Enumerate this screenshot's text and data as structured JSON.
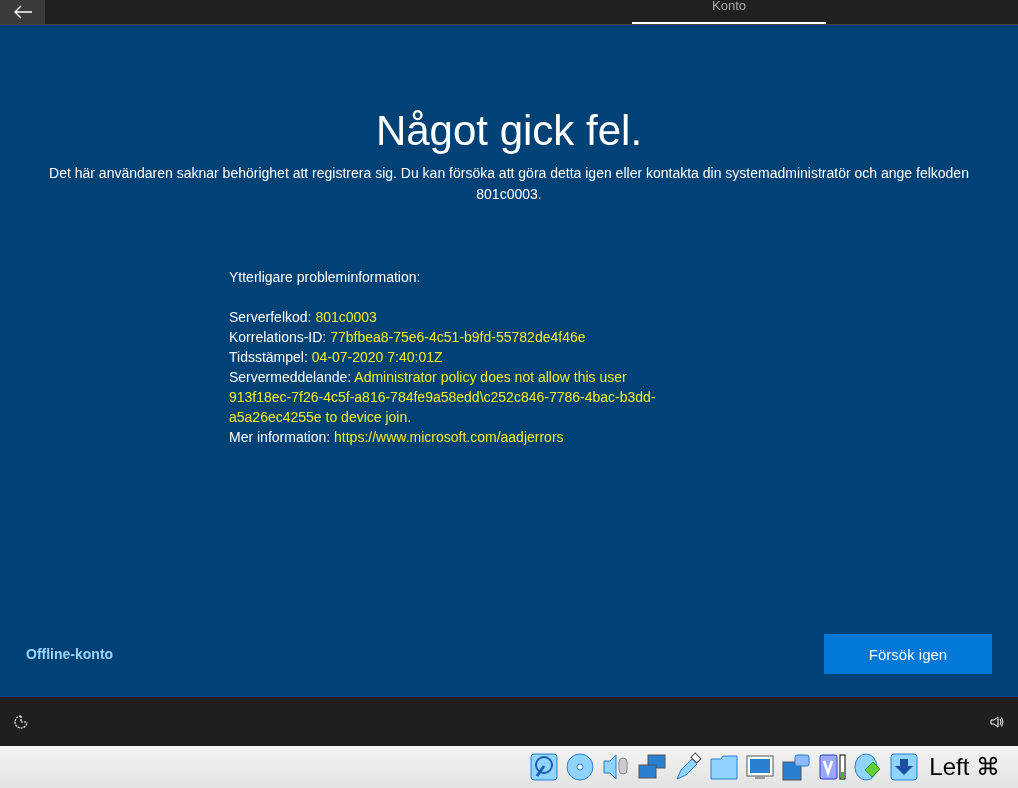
{
  "top_bar": {
    "tabs": [
      {
        "label": "Konto",
        "selected": true
      }
    ]
  },
  "heading": "Något gick fel.",
  "description": "Det här användaren saknar behörighet att registrera sig. Du kan försöka att göra detta igen eller kontakta din systemadministratör och ange felkoden 801c0003.",
  "details": {
    "title": "Ytterligare probleminformation:",
    "rows": [
      {
        "label": "Serverfelkod:",
        "value": "801c0003"
      },
      {
        "label": "Korrelations-ID:",
        "value": "77bfbea8-75e6-4c51-b9fd-55782de4f46e"
      },
      {
        "label": "Tidsstämpel:",
        "value": "04-07-2020 7:40:01Z"
      },
      {
        "label": "Servermeddelande:",
        "value": "Administrator policy does not allow this user 913f18ec-7f26-4c5f-a816-784fe9a58edd\\c252c846-7786-4bac-b3dd-a5a26ec4255e to device join."
      },
      {
        "label": "Mer information:",
        "value": "https://www.microsoft.com/aadjerrors"
      }
    ]
  },
  "offline_link": "Offline-konto",
  "retry_button": "Försök igen",
  "host_key": "Left ⌘"
}
